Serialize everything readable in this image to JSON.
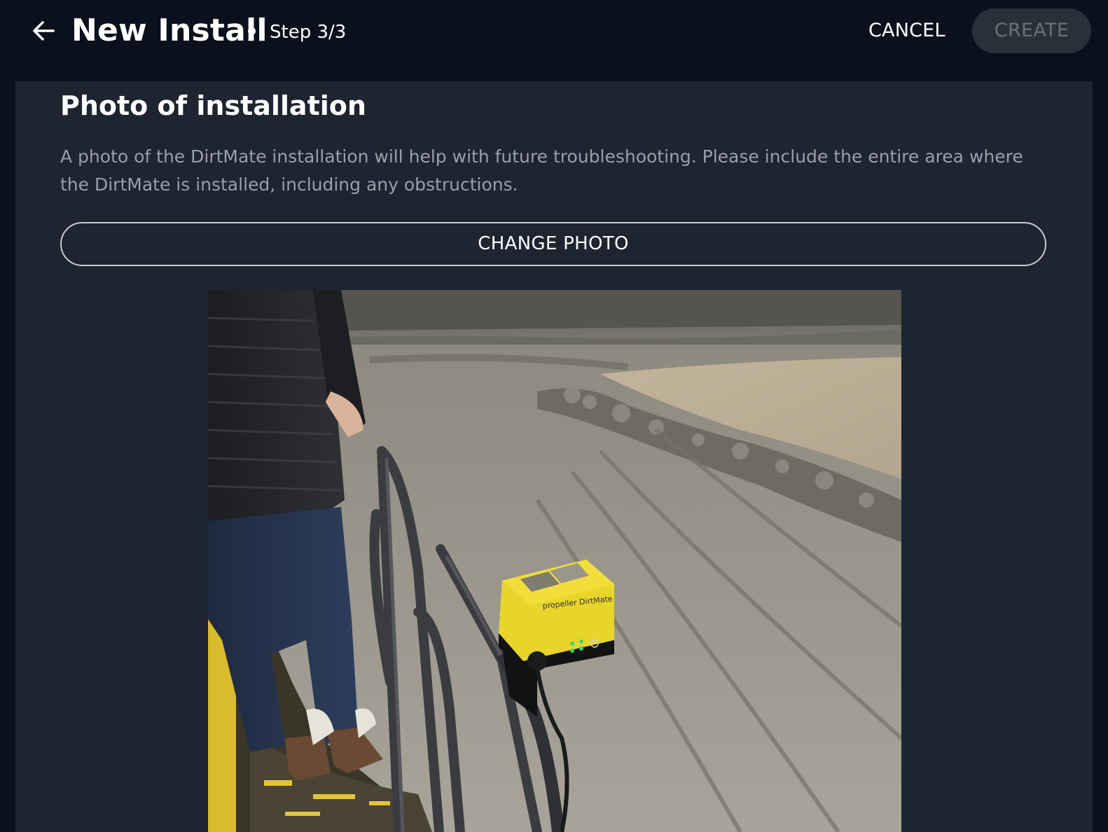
{
  "header": {
    "back_icon": "arrow-left-icon",
    "title": "New Install",
    "step": "Step 3/3",
    "cancel_label": "CANCEL",
    "create_label": "CREATE"
  },
  "section": {
    "title": "Photo of installation",
    "description": "A photo of the DirtMate installation will help with future troubleshooting. Please include the entire area where the DirtMate is installed, including any obstructions.",
    "change_photo_label": "CHANGE PHOTO"
  },
  "photo": {
    "device_brand_text": "propeller DirtMate"
  },
  "colors": {
    "background": "#0b111c",
    "panel": "#1e2430",
    "create_disabled_bg": "#2a303a",
    "create_disabled_text": "#6b717b",
    "muted_text": "#9aa0a9"
  }
}
